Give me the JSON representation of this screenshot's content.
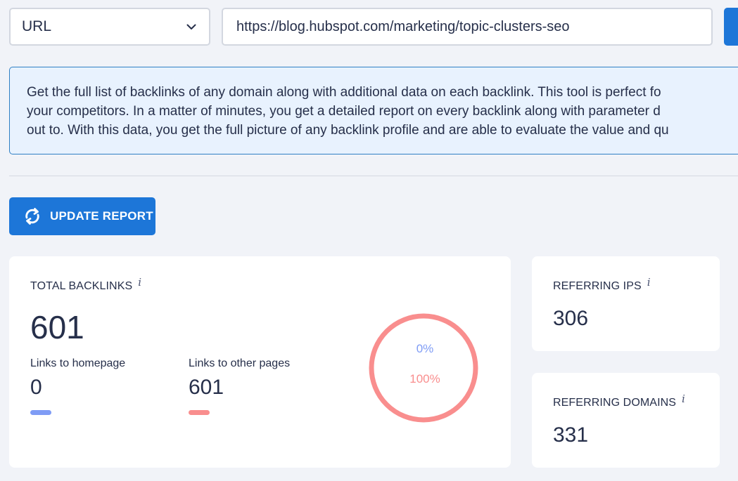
{
  "search": {
    "type_value": "URL",
    "url_value": "https://blog.hubspot.com/marketing/topic-clusters-seo"
  },
  "info": {
    "lines": [
      "Get the full list of backlinks of any domain along with additional data on each backlink. This tool is perfect fo",
      "your competitors. In a matter of minutes, you get a detailed report on every backlink along with parameter d",
      "out to. With this data, you get the full picture of any backlink profile and are able to evaluate the value and qu"
    ]
  },
  "update_button": {
    "label": "UPDATE REPORT"
  },
  "total_backlinks": {
    "title": "TOTAL BACKLINKS",
    "info": "i",
    "value": "601",
    "homepage": {
      "label": "Links to homepage",
      "value": "0",
      "color": "#7f9cf5"
    },
    "other": {
      "label": "Links to other pages",
      "value": "601",
      "color": "#f98e8e"
    },
    "donut": {
      "homepage_pct_label": "0%",
      "other_pct_label": "100%",
      "homepage_fraction": 0,
      "other_fraction": 1
    }
  },
  "referring_ips": {
    "title": "REFERRING IPS",
    "info": "i",
    "value": "306"
  },
  "referring_domains": {
    "title": "REFERRING DOMAINS",
    "info": "i",
    "value": "331"
  },
  "colors": {
    "accent": "#1d76d8",
    "homepage": "#7f9cf5",
    "other": "#f98e8e"
  }
}
